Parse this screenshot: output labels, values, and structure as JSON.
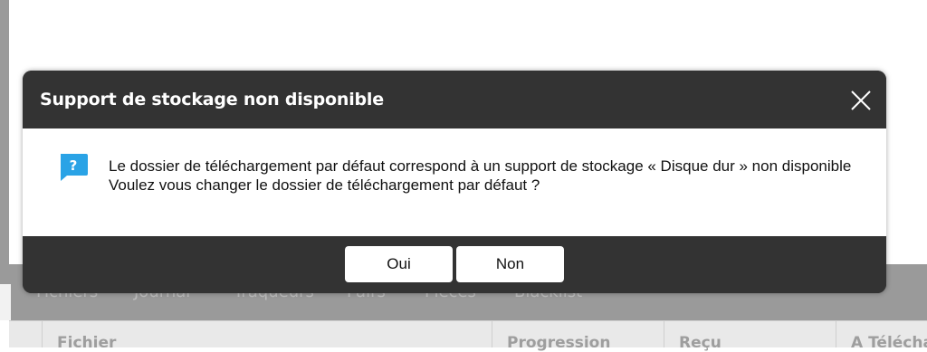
{
  "background": {
    "tabs": [
      "Fichiers",
      "Journal",
      "Traqueurs",
      "Pairs",
      "Pièces",
      "Blacklist"
    ],
    "columns": [
      "Fichier",
      "Progression",
      "Reçu",
      "A Téléchar"
    ]
  },
  "dialog": {
    "title": "Support de stockage non disponible",
    "icon": "question-icon",
    "message_line1": "Le dossier de téléchargement par défaut correspond à un support de stockage « Disque dur » non disponible",
    "message_line2": "Voulez vous changer le dossier de téléchargement par défaut ?",
    "yes_label": "Oui",
    "no_label": "Non"
  },
  "colors": {
    "dialog_header": "#333333",
    "icon_blue": "#2aa3e6",
    "overlay_gray": "#9a9a9a"
  }
}
